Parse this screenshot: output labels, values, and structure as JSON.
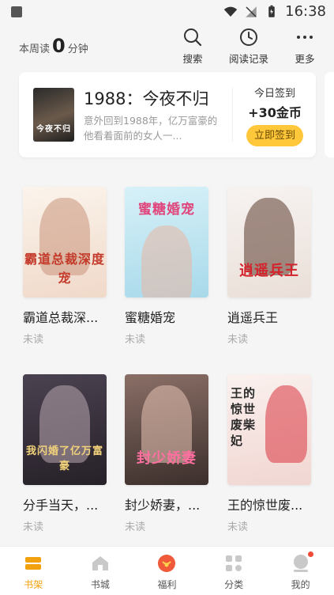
{
  "statusbar": {
    "time": "16:38"
  },
  "header": {
    "weekly_prefix": "本周读",
    "weekly_minutes": "0",
    "weekly_suffix": "分钟",
    "actions": [
      {
        "label": "搜索",
        "icon": "search-icon"
      },
      {
        "label": "阅读记录",
        "icon": "clock-icon"
      },
      {
        "label": "更多",
        "icon": "more-icon"
      }
    ]
  },
  "featured": {
    "cover_text": "今夜不归",
    "title": "1988：今夜不归",
    "description": "意外回到1988年，亿万富豪的他看着面前的女人一...",
    "signin_title": "今日签到",
    "signin_reward": "+30金币",
    "signin_button": "立即签到"
  },
  "books": [
    {
      "title": "霸道总裁深...",
      "status": "未读",
      "cover_text": "霸道总裁深度宠",
      "color": "#f3e3d3"
    },
    {
      "title": "蜜糖婚宠",
      "status": "未读",
      "cover_text": "蜜糖婚宠",
      "color": "#bde3f0"
    },
    {
      "title": "逍遥兵王",
      "status": "未读",
      "cover_text": "逍遥兵王",
      "color": "#f1ece8"
    },
    {
      "title": "分手当天，...",
      "status": "未读",
      "cover_text": "我闪婚了亿万富豪",
      "color": "#3a3440"
    },
    {
      "title": "封少娇妻，...",
      "status": "未读",
      "cover_text": "封少娇妻",
      "color": "#6f5a52"
    },
    {
      "title": "王的惊世废...",
      "status": "未读",
      "cover_text": "王的惊世废柴妃",
      "color": "#f3e6e2"
    }
  ],
  "tabs": [
    {
      "label": "书架",
      "active": true
    },
    {
      "label": "书城",
      "active": false
    },
    {
      "label": "福利",
      "active": false
    },
    {
      "label": "分类",
      "active": false
    },
    {
      "label": "我的",
      "active": false
    }
  ],
  "colors": {
    "accent": "#f3a20f",
    "button": "#ffc83b",
    "badge": "#f04b37"
  }
}
